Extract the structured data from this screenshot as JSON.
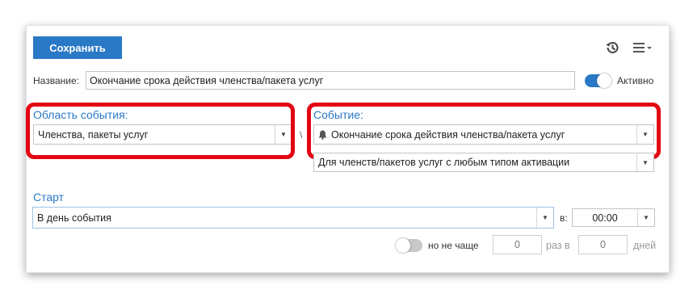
{
  "toolbar": {
    "save_label": "Сохранить",
    "history_icon": "history-icon",
    "menu_icon": "hamburger-menu-icon"
  },
  "name_row": {
    "label": "Название:",
    "value": "Окончание срока действия членства/пакета услуг",
    "active_label": "Активно",
    "active_on": true
  },
  "event_scope": {
    "label": "Область события:",
    "value": "Членства, пакеты услуг"
  },
  "separator": "\\",
  "event": {
    "label": "Событие:",
    "value": "Окончание срока действия членства/пакета услуг",
    "icon": "bell-icon"
  },
  "activation_filter": {
    "value": "Для членств/пакетов услуг с любым типом активации"
  },
  "start": {
    "label": "Старт",
    "value": "В день события",
    "at_label": "в:",
    "time": "00:00"
  },
  "frequency": {
    "enabled": false,
    "not_more_label": "но не чаще",
    "times_value": "0",
    "times_label": "раз в",
    "days_value": "0",
    "days_label": "дней"
  },
  "colors": {
    "accent": "#2a79c6",
    "highlight": "#e30613"
  }
}
